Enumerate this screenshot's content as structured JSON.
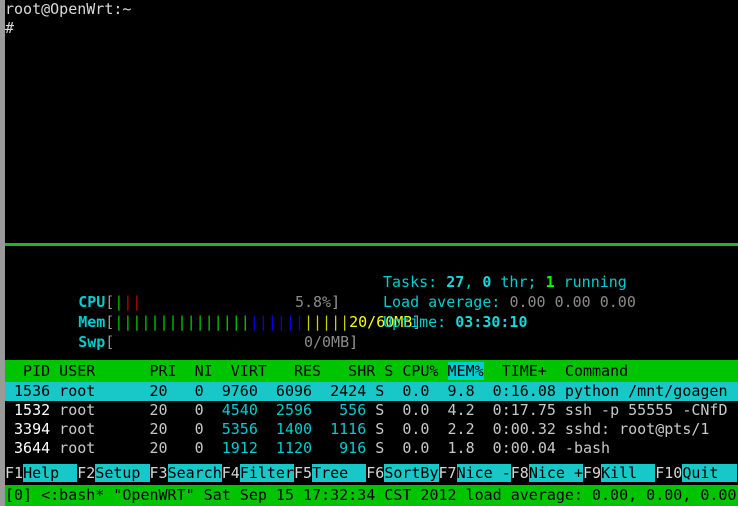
{
  "terminal": {
    "prompt_line": "root@OpenWrt:~",
    "command_line": "#"
  },
  "meters": {
    "cpu": {
      "label": "CPU",
      "open_bracket": "[",
      "close_bracket": "]",
      "value_text": "5.8%",
      "bars": [
        "green",
        "red",
        "red"
      ],
      "total_slots": 24
    },
    "mem": {
      "label": "Mem",
      "open_bracket": "[",
      "close_bracket": "]",
      "value_text": "20/60MB",
      "bars": [
        "green",
        "green",
        "green",
        "green",
        "green",
        "green",
        "green",
        "green",
        "green",
        "green",
        "green",
        "green",
        "green",
        "green",
        "green",
        "blue",
        "blue",
        "blue",
        "blue",
        "blue",
        "blue",
        "yellow",
        "yellow",
        "yellow",
        "yellow",
        "yellow"
      ],
      "total_slots": 26
    },
    "swp": {
      "label": "Swp",
      "open_bracket": "[",
      "close_bracket": "]",
      "value_text": "0/0MB",
      "bars": [],
      "total_slots": 26
    }
  },
  "sysinfo": {
    "tasks_label": "Tasks: ",
    "tasks_count": "27",
    "tasks_sep1": ", ",
    "thr_count": "0",
    "thr_label": " thr; ",
    "running_count": "1",
    "running_label": " running",
    "load_label": "Load average: ",
    "load_values": "0.00 0.00 0.00",
    "uptime_label": "Uptime: ",
    "uptime_value": "03:30:10"
  },
  "table": {
    "headers": [
      "PID",
      "USER",
      "PRI",
      "NI",
      "VIRT",
      "RES",
      "SHR",
      "S",
      "CPU%",
      "MEM%",
      "TIME+",
      "Command"
    ],
    "sort_column": "MEM%",
    "header_line_pre": "  PID USER      PRI  NI  VIRT   RES   SHR S CPU% ",
    "header_sort": "MEM%",
    "header_line_post": "  TIME+  Command",
    "rows": [
      {
        "pid": "1536",
        "user": "root",
        "pri": "20",
        "ni": "0",
        "virt": "9760",
        "res": "6096",
        "shr": "2424",
        "state": "S",
        "cpu": "0.0",
        "mem": "9.8",
        "time": "0:16.08",
        "command": "python /mnt/goagen",
        "selected": true
      },
      {
        "pid": "1532",
        "user": "root",
        "pri": "20",
        "ni": "0",
        "virt": "4540",
        "res": "2596",
        "shr": "556",
        "state": "S",
        "cpu": "0.0",
        "mem": "4.2",
        "time": "0:17.75",
        "command": "ssh -p 55555 -CNfD",
        "selected": false
      },
      {
        "pid": "3394",
        "user": "root",
        "pri": "20",
        "ni": "0",
        "virt": "5356",
        "res": "1400",
        "shr": "1116",
        "state": "S",
        "cpu": "0.0",
        "mem": "2.2",
        "time": "0:00.32",
        "command": "sshd: root@pts/1",
        "selected": false
      },
      {
        "pid": "3644",
        "user": "root",
        "pri": "20",
        "ni": "0",
        "virt": "1912",
        "res": "1120",
        "shr": "916",
        "state": "S",
        "cpu": "0.0",
        "mem": "1.8",
        "time": "0:00.04",
        "command": "-bash",
        "selected": false
      }
    ]
  },
  "function_keys": [
    {
      "key": "F1",
      "label": "Help  "
    },
    {
      "key": "F2",
      "label": "Setup "
    },
    {
      "key": "F3",
      "label": "Search"
    },
    {
      "key": "F4",
      "label": "Filter"
    },
    {
      "key": "F5",
      "label": "Tree  "
    },
    {
      "key": "F6",
      "label": "SortBy"
    },
    {
      "key": "F7",
      "label": "Nice -"
    },
    {
      "key": "F8",
      "label": "Nice +"
    },
    {
      "key": "F9",
      "label": "Kill  "
    },
    {
      "key": "F10",
      "label": "Quit  "
    }
  ],
  "statusbar": {
    "text": "[0] <:bash* \"OpenWRT\" Sat Sep 15 17:32:34 CST 2012 load average: 0.00, 0.00, 0.00"
  },
  "colors": {
    "bg": "#000000",
    "header_green": "#00c400",
    "select_cyan": "#18c7c7",
    "cyan": "#00cdcd",
    "bar_green": "#00cd00",
    "bar_red": "#cd0000",
    "bar_blue": "#0000ee",
    "bar_yellow": "#cdcd00",
    "left_strip": "#9a9a9a",
    "rule_green": "#1cb81c"
  }
}
